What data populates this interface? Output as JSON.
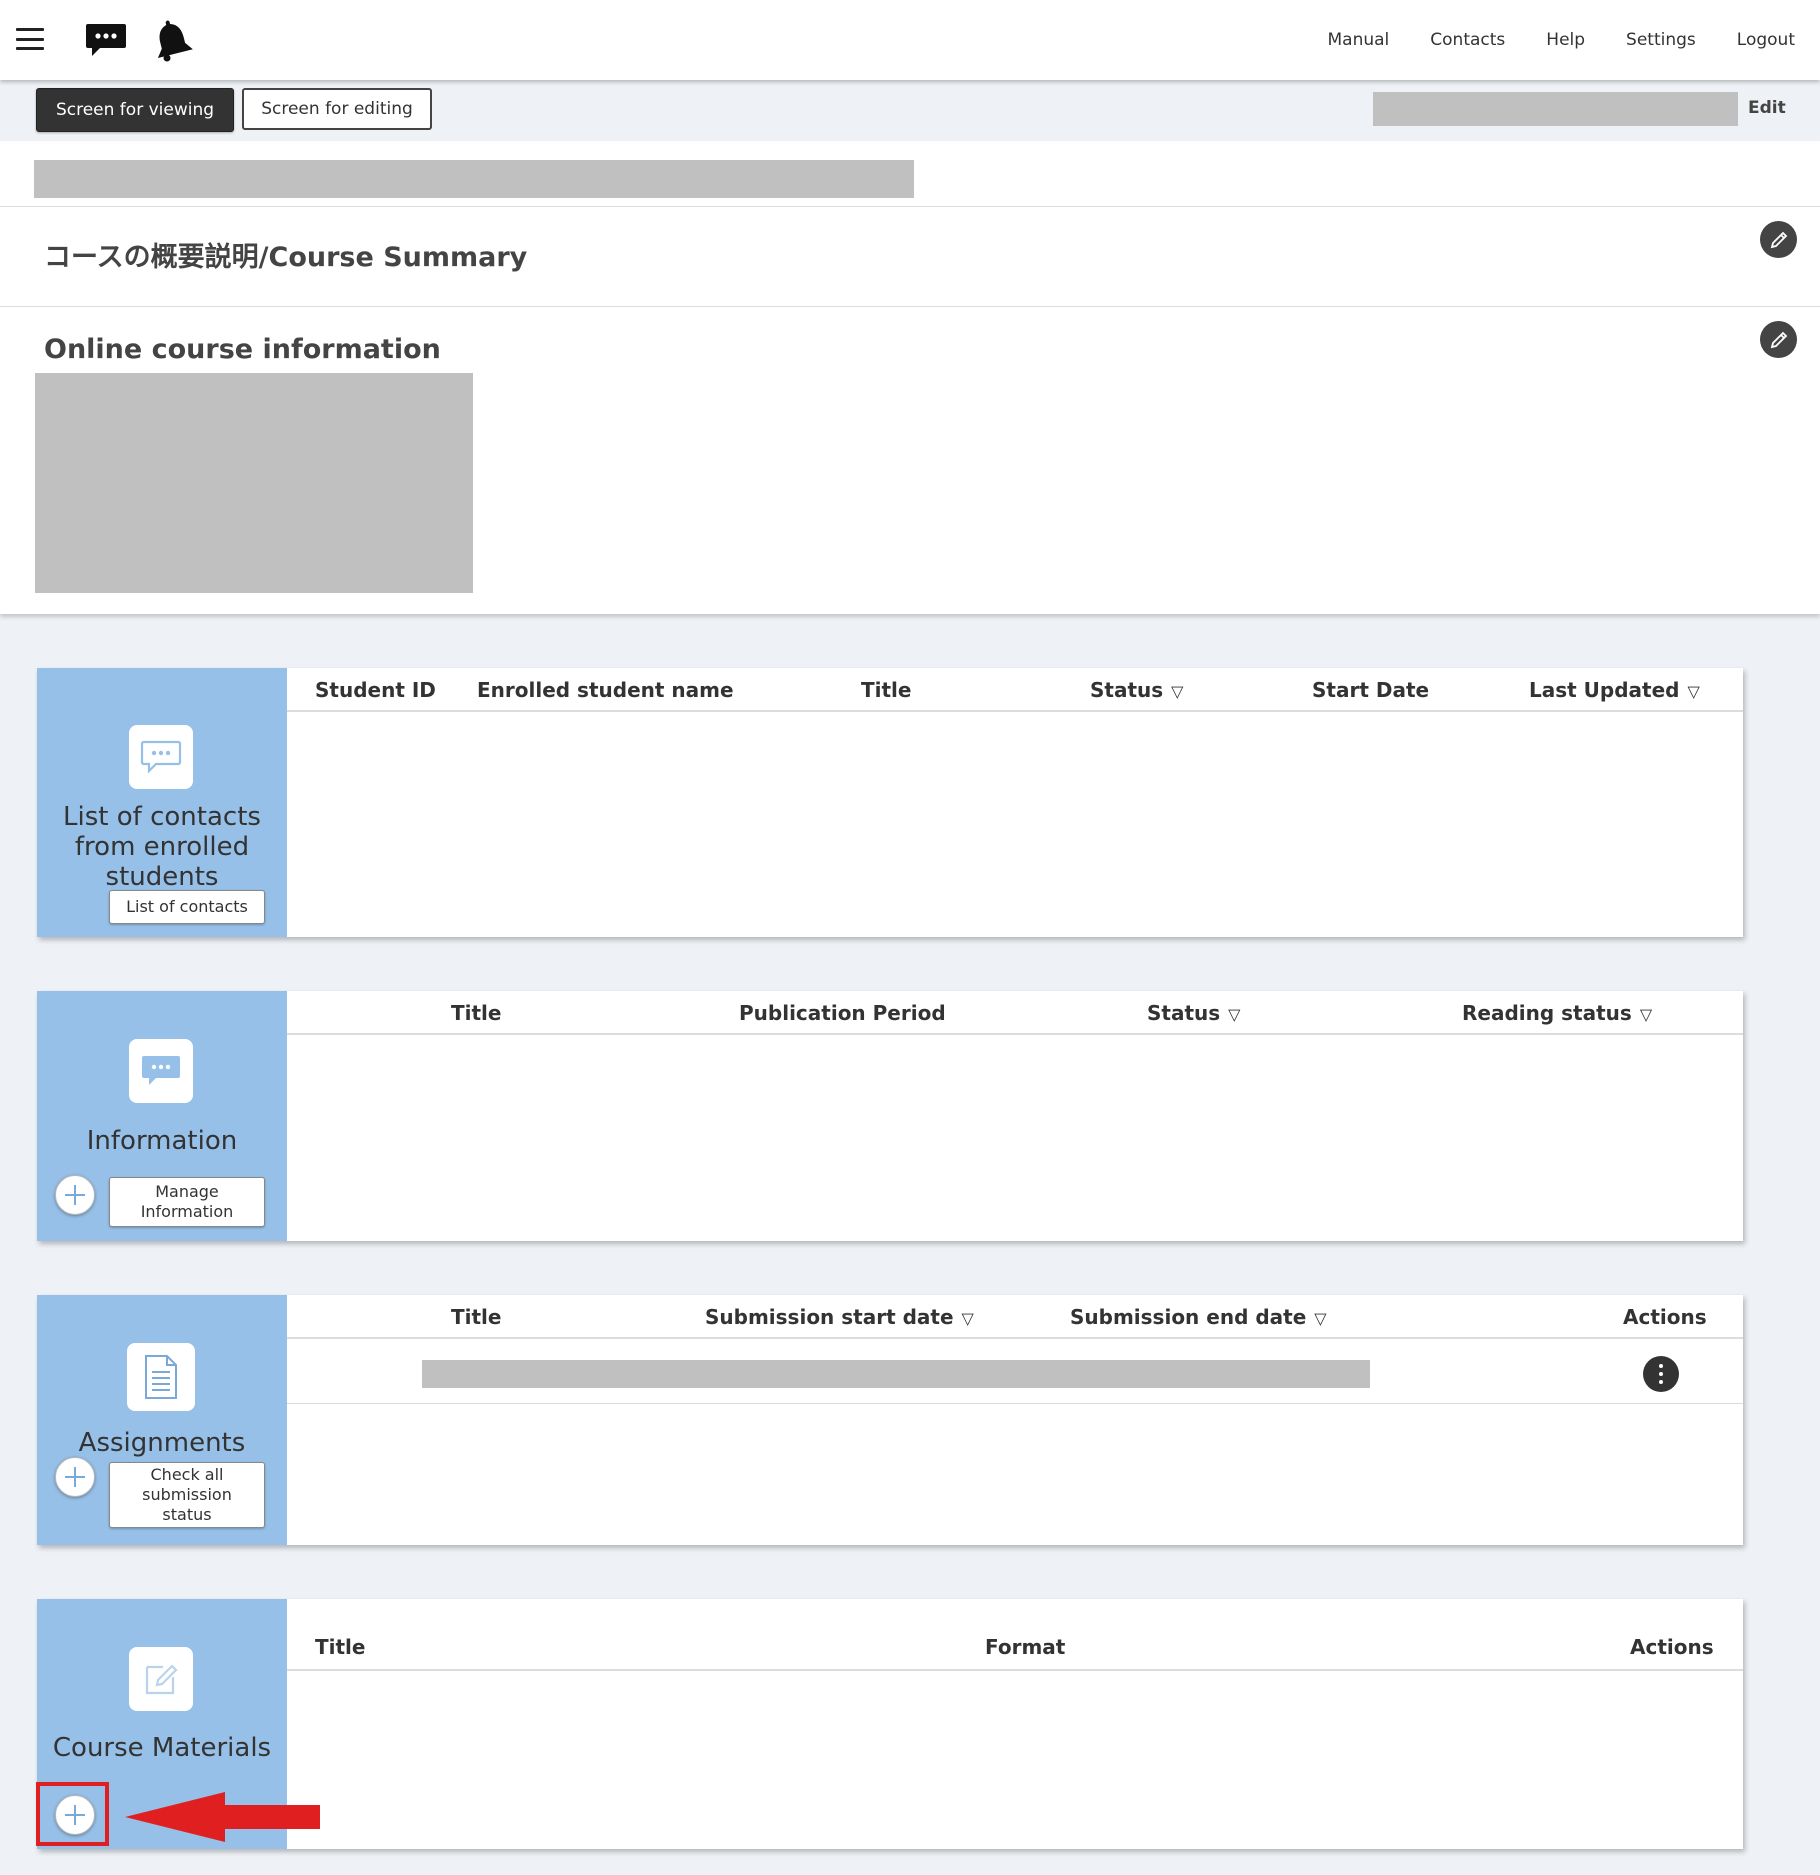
{
  "header": {
    "icons": [
      "menu-icon",
      "chat-icon",
      "bell-icon"
    ],
    "nav": [
      "Manual",
      "Contacts",
      "Help",
      "Settings",
      "Logout"
    ]
  },
  "modebar": {
    "view_label": "Screen for viewing",
    "edit_label": "Screen for editing",
    "edit_link": "Edit"
  },
  "course": {
    "summary_title": "コースの概要説明/Course Summary",
    "online_title": "Online course information"
  },
  "panels": {
    "contacts": {
      "title_lines": [
        "List of contacts",
        "from enrolled",
        "students"
      ],
      "button": "List of contacts",
      "columns": [
        "Student ID",
        "Enrolled student name",
        "Title",
        "Status",
        "Start Date",
        "Last Updated"
      ],
      "sortable": [
        "Status",
        "Last Updated"
      ]
    },
    "information": {
      "title": "Information",
      "button_lines": [
        "Manage",
        "Information"
      ],
      "columns": [
        "Title",
        "Publication Period",
        "Status",
        "Reading status"
      ],
      "sortable": [
        "Status",
        "Reading status"
      ]
    },
    "assignments": {
      "title": "Assignments",
      "button_lines": [
        "Check all",
        "submission",
        "status"
      ],
      "columns": [
        "Title",
        "Submission start date",
        "Submission end date",
        "Actions"
      ],
      "sortable": [
        "Submission start date",
        "Submission end date"
      ]
    },
    "materials": {
      "title": "Course Materials",
      "columns": [
        "Title",
        "Format",
        "Actions"
      ]
    }
  },
  "colors": {
    "sidebar": "#96c0e8",
    "dark_button": "#333333",
    "highlight": "#e02020"
  },
  "sort_glyph": "▽"
}
